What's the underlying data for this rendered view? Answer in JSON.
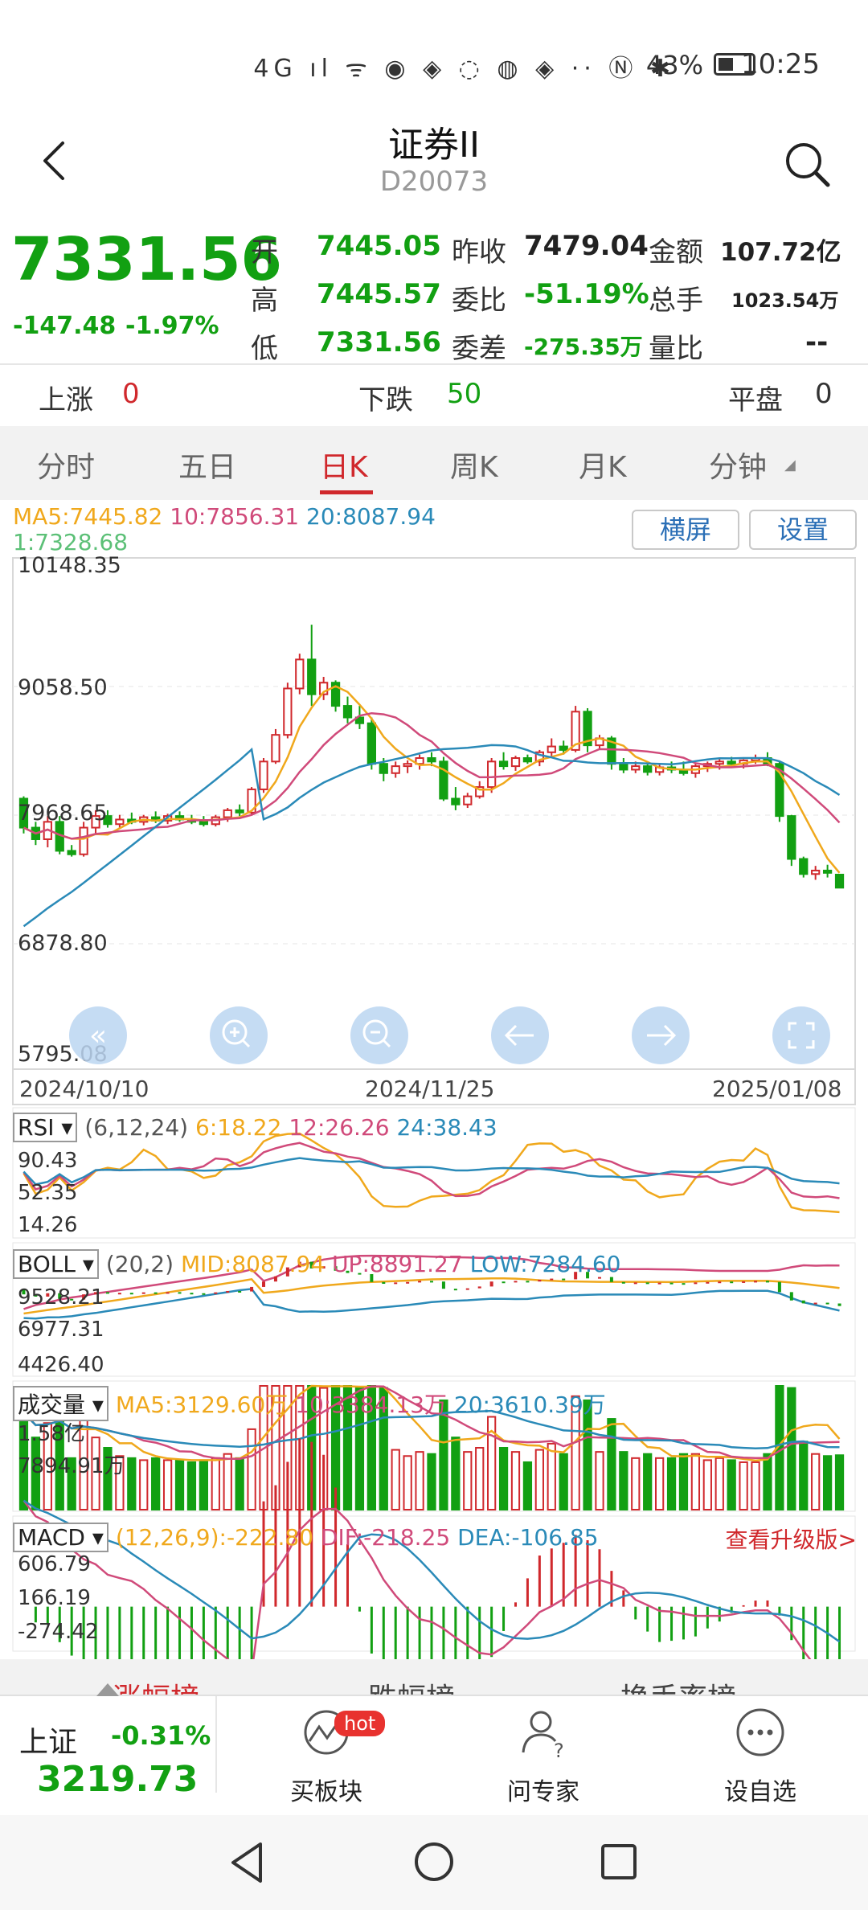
{
  "status": {
    "battery": "43%",
    "time": "10:25",
    "icons_text": "4G ıl ᯤ ◉ ◈ ◌ ◍ ◈ ·· Ⓝ ✱"
  },
  "header": {
    "title": "证券II",
    "code": "D20073"
  },
  "quote": {
    "price": "7331.56",
    "change": "-147.48",
    "change_pct": "-1.97%",
    "rows": [
      {
        "l1": "开",
        "v1": "7445.05",
        "l2": "昨收",
        "v2": "7479.04",
        "l3": "金额",
        "v3": "107.72亿"
      },
      {
        "l1": "高",
        "v1": "7445.57",
        "l2": "委比",
        "v2": "-51.19%",
        "l3": "总手",
        "v3": "1023.54万"
      },
      {
        "l1": "低",
        "v1": "7331.56",
        "l2": "委差",
        "v2": "-275.35万",
        "l3": "量比",
        "v3": "--"
      }
    ]
  },
  "breadth": {
    "up_label": "上涨",
    "up": "0",
    "down_label": "下跌",
    "down": "50",
    "flat_label": "平盘",
    "flat": "0"
  },
  "tabs": [
    "分时",
    "五日",
    "日K",
    "周K",
    "月K",
    "分钟"
  ],
  "ma": {
    "ma5": "MA5:7445.82",
    "ma10": "10:7856.31",
    "ma20": "20:8087.94",
    "ma1": "1:7328.68"
  },
  "buttons": {
    "landscape": "横屏",
    "settings": "设置"
  },
  "kline": {
    "y_labels": [
      "10148.35",
      "9058.50",
      "7968.65",
      "6878.80",
      "5795.08"
    ],
    "x_labels": [
      "2024/10/10",
      "2024/11/25",
      "2025/01/08"
    ]
  },
  "rsi": {
    "name": "RSI",
    "params": "(6,12,24)",
    "v6": "6:18.22",
    "v12": "12:26.26",
    "v24": "24:38.43",
    "y_labels": [
      "90.43",
      "52.35",
      "14.26"
    ]
  },
  "boll": {
    "name": "BOLL",
    "params": "(20,2)",
    "mid": "MID:8087.94",
    "up": "UP:8891.27",
    "low": "LOW:7284.60",
    "y_labels": [
      "9528.21",
      "6977.31",
      "4426.40"
    ]
  },
  "vol": {
    "name": "成交量",
    "ma5": "MA5:3129.60万",
    "ma10": "10:3384.13万",
    "ma20": "20:3610.39万",
    "y_labels": [
      "1.58亿",
      "7894.91万"
    ]
  },
  "macd": {
    "name": "MACD",
    "params": "(12,26,9):-222.80",
    "dif": "DIF:-218.25",
    "dea": "DEA:-106.85",
    "upgrade": "查看升级版>",
    "y_labels": [
      "606.79",
      "166.19",
      "-274.42"
    ]
  },
  "rank_tabs": [
    "涨幅榜",
    "跌幅榜",
    "换手率榜"
  ],
  "bottom": {
    "index_name": "上证",
    "index_chg": "-0.31%",
    "index_val": "3219.73",
    "items": [
      {
        "label": "买板块",
        "badge": "hot"
      },
      {
        "label": "问专家"
      },
      {
        "label": "设自选"
      }
    ]
  },
  "colors": {
    "up": "#d0282c",
    "down": "#12a012",
    "ma5": "#f0a81c",
    "ma10": "#d04a7a",
    "ma20": "#2a8ab8",
    "ma1": "#5cc077"
  },
  "chart_data": {
    "type": "candlestick",
    "candles": [
      {
        "o": 8100,
        "h": 8120,
        "l": 7800,
        "c": 7850
      },
      {
        "o": 7850,
        "h": 7900,
        "l": 7700,
        "c": 7750
      },
      {
        "o": 7750,
        "h": 7950,
        "l": 7680,
        "c": 7900
      },
      {
        "o": 7900,
        "h": 7950,
        "l": 7620,
        "c": 7650
      },
      {
        "o": 7650,
        "h": 7700,
        "l": 7600,
        "c": 7620
      },
      {
        "o": 7620,
        "h": 7900,
        "l": 7600,
        "c": 7850
      },
      {
        "o": 7850,
        "h": 8000,
        "l": 7800,
        "c": 7950
      },
      {
        "o": 7950,
        "h": 8000,
        "l": 7850,
        "c": 7880
      },
      {
        "o": 7880,
        "h": 7960,
        "l": 7850,
        "c": 7920
      },
      {
        "o": 7920,
        "h": 7980,
        "l": 7880,
        "c": 7900
      },
      {
        "o": 7900,
        "h": 7960,
        "l": 7870,
        "c": 7940
      },
      {
        "o": 7940,
        "h": 7990,
        "l": 7890,
        "c": 7910
      },
      {
        "o": 7910,
        "h": 7970,
        "l": 7880,
        "c": 7950
      },
      {
        "o": 7950,
        "h": 7990,
        "l": 7900,
        "c": 7920
      },
      {
        "o": 7920,
        "h": 7960,
        "l": 7880,
        "c": 7900
      },
      {
        "o": 7900,
        "h": 7950,
        "l": 7860,
        "c": 7880
      },
      {
        "o": 7880,
        "h": 7960,
        "l": 7860,
        "c": 7940
      },
      {
        "o": 7940,
        "h": 8020,
        "l": 7900,
        "c": 8000
      },
      {
        "o": 8000,
        "h": 8050,
        "l": 7950,
        "c": 7980
      },
      {
        "o": 7980,
        "h": 8200,
        "l": 7960,
        "c": 8180
      },
      {
        "o": 8180,
        "h": 8450,
        "l": 8150,
        "c": 8420
      },
      {
        "o": 8420,
        "h": 8700,
        "l": 8400,
        "c": 8650
      },
      {
        "o": 8650,
        "h": 9100,
        "l": 8620,
        "c": 9050
      },
      {
        "o": 9050,
        "h": 9350,
        "l": 9000,
        "c": 9300
      },
      {
        "o": 9300,
        "h": 9600,
        "l": 8900,
        "c": 9000
      },
      {
        "o": 9000,
        "h": 9150,
        "l": 8950,
        "c": 9100
      },
      {
        "o": 9100,
        "h": 9120,
        "l": 8850,
        "c": 8900
      },
      {
        "o": 8900,
        "h": 8980,
        "l": 8750,
        "c": 8800
      },
      {
        "o": 8800,
        "h": 8900,
        "l": 8700,
        "c": 8750
      },
      {
        "o": 8750,
        "h": 8800,
        "l": 8350,
        "c": 8400
      },
      {
        "o": 8400,
        "h": 8450,
        "l": 8250,
        "c": 8320
      },
      {
        "o": 8320,
        "h": 8420,
        "l": 8280,
        "c": 8380
      },
      {
        "o": 8380,
        "h": 8430,
        "l": 8320,
        "c": 8400
      },
      {
        "o": 8400,
        "h": 8480,
        "l": 8350,
        "c": 8450
      },
      {
        "o": 8450,
        "h": 8500,
        "l": 8380,
        "c": 8420
      },
      {
        "o": 8420,
        "h": 8460,
        "l": 8080,
        "c": 8100
      },
      {
        "o": 8100,
        "h": 8200,
        "l": 8000,
        "c": 8050
      },
      {
        "o": 8050,
        "h": 8150,
        "l": 8020,
        "c": 8120
      },
      {
        "o": 8120,
        "h": 8250,
        "l": 8100,
        "c": 8200
      },
      {
        "o": 8200,
        "h": 8450,
        "l": 8150,
        "c": 8420
      },
      {
        "o": 8420,
        "h": 8500,
        "l": 8350,
        "c": 8380
      },
      {
        "o": 8380,
        "h": 8470,
        "l": 8340,
        "c": 8450
      },
      {
        "o": 8450,
        "h": 8480,
        "l": 8400,
        "c": 8420
      },
      {
        "o": 8420,
        "h": 8520,
        "l": 8380,
        "c": 8500
      },
      {
        "o": 8500,
        "h": 8620,
        "l": 8450,
        "c": 8550
      },
      {
        "o": 8550,
        "h": 8600,
        "l": 8480,
        "c": 8520
      },
      {
        "o": 8520,
        "h": 8900,
        "l": 8500,
        "c": 8850
      },
      {
        "o": 8850,
        "h": 8880,
        "l": 8500,
        "c": 8560
      },
      {
        "o": 8560,
        "h": 8650,
        "l": 8520,
        "c": 8620
      },
      {
        "o": 8620,
        "h": 8640,
        "l": 8350,
        "c": 8400
      },
      {
        "o": 8400,
        "h": 8450,
        "l": 8320,
        "c": 8350
      },
      {
        "o": 8350,
        "h": 8420,
        "l": 8320,
        "c": 8380
      },
      {
        "o": 8380,
        "h": 8420,
        "l": 8300,
        "c": 8330
      },
      {
        "o": 8330,
        "h": 8400,
        "l": 8300,
        "c": 8370
      },
      {
        "o": 8370,
        "h": 8420,
        "l": 8320,
        "c": 8350
      },
      {
        "o": 8350,
        "h": 8420,
        "l": 8300,
        "c": 8320
      },
      {
        "o": 8320,
        "h": 8400,
        "l": 8280,
        "c": 8380
      },
      {
        "o": 8380,
        "h": 8420,
        "l": 8330,
        "c": 8400
      },
      {
        "o": 8400,
        "h": 8450,
        "l": 8350,
        "c": 8420
      },
      {
        "o": 8420,
        "h": 8460,
        "l": 8370,
        "c": 8400
      },
      {
        "o": 8400,
        "h": 8440,
        "l": 8360,
        "c": 8430
      },
      {
        "o": 8430,
        "h": 8480,
        "l": 8400,
        "c": 8450
      },
      {
        "o": 8450,
        "h": 8500,
        "l": 8380,
        "c": 8400
      },
      {
        "o": 8400,
        "h": 8420,
        "l": 7900,
        "c": 7950
      },
      {
        "o": 7950,
        "h": 7960,
        "l": 7520,
        "c": 7580
      },
      {
        "o": 7580,
        "h": 7600,
        "l": 7420,
        "c": 7450
      },
      {
        "o": 7450,
        "h": 7520,
        "l": 7400,
        "c": 7480
      },
      {
        "o": 7480,
        "h": 7530,
        "l": 7420,
        "c": 7460
      },
      {
        "o": 7445,
        "h": 7446,
        "l": 7332,
        "c": 7332
      }
    ]
  }
}
